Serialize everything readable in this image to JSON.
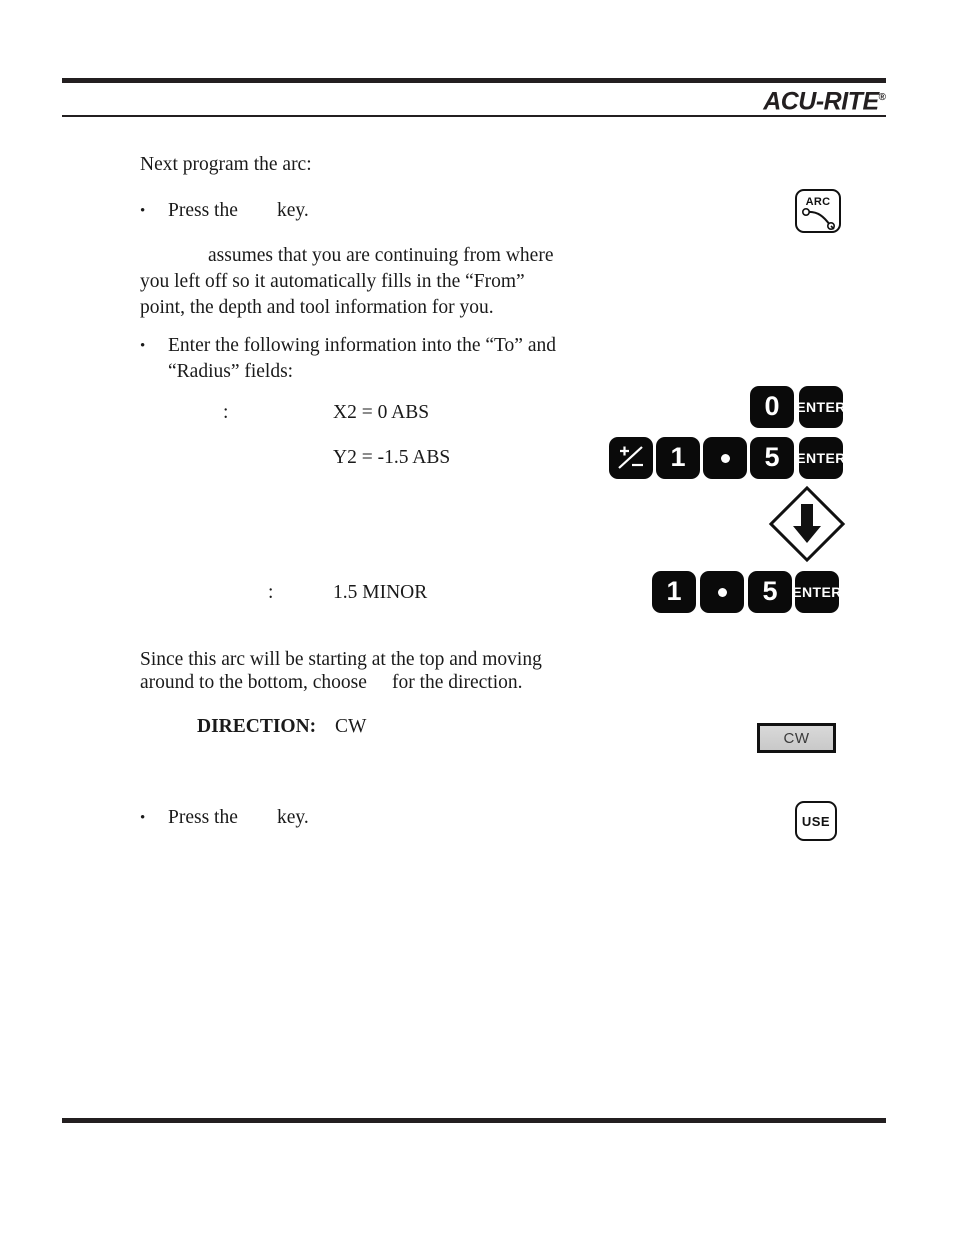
{
  "page": {
    "brand": "ACU-RITE",
    "brand_registered_mark": "®",
    "accent_color": "#231f20",
    "background_color": "#ffffff"
  },
  "body": {
    "intro": "Next program the arc:",
    "step1": {
      "bullet": "•",
      "text_before": "Press the",
      "text_after": "key."
    },
    "paragraph1": "assumes that you are continuing from where you left off so it automatically fills in the “From” point, the depth and tool information for you.",
    "step2": {
      "bullet": "•",
      "line1": "Enter the following information into the “To” and",
      "line2": "“Radius” fields:"
    },
    "to_field": {
      "label_colon": ":",
      "value_x": "X2 = 0 ABS",
      "value_y": "Y2 = -1.5 ABS"
    },
    "radius_field": {
      "label_colon": ":",
      "value": "1.5 MINOR"
    },
    "paragraph2_line1": "Since this arc will be starting at the top and moving",
    "paragraph2_line2a": "around to the bottom, choose",
    "paragraph2_line2b": "for the direction.",
    "direction": {
      "label": "DIRECTION:",
      "value": "CW"
    },
    "step3": {
      "bullet": "•",
      "text_before": "Press the",
      "text_after": "key."
    }
  },
  "keys": {
    "arc": {
      "name": "arc-key",
      "label": "ARC",
      "icon": "arc-curve-icon",
      "style": "white-outline"
    },
    "zero": {
      "name": "zero-key",
      "label": "0",
      "style": "black"
    },
    "enter1": {
      "name": "enter-key",
      "label": "ENTER",
      "style": "black"
    },
    "plusminus": {
      "name": "plus-minus-key",
      "label": "+/-",
      "icon": "plus-minus-icon",
      "style": "black"
    },
    "one_a": {
      "name": "one-key",
      "label": "1",
      "style": "black"
    },
    "dot_a": {
      "name": "decimal-point-key",
      "label": "•",
      "icon": "dot-icon",
      "style": "black"
    },
    "five_a": {
      "name": "five-key",
      "label": "5",
      "style": "black"
    },
    "enter2": {
      "name": "enter-key",
      "label": "ENTER",
      "style": "black"
    },
    "arrow_down": {
      "name": "arrow-down-key",
      "label": "",
      "icon": "arrow-down-icon",
      "style": "white-diamond"
    },
    "one_b": {
      "name": "one-key",
      "label": "1",
      "style": "black"
    },
    "dot_b": {
      "name": "decimal-point-key",
      "label": "•",
      "icon": "dot-icon",
      "style": "black"
    },
    "five_b": {
      "name": "five-key",
      "label": "5",
      "style": "black"
    },
    "enter3": {
      "name": "enter-key",
      "label": "ENTER",
      "style": "black"
    },
    "cw_softkey": {
      "name": "cw-softkey",
      "label": "CW",
      "style": "gray-softkey"
    },
    "use": {
      "name": "use-key",
      "label": "USE",
      "style": "white-outline"
    }
  }
}
